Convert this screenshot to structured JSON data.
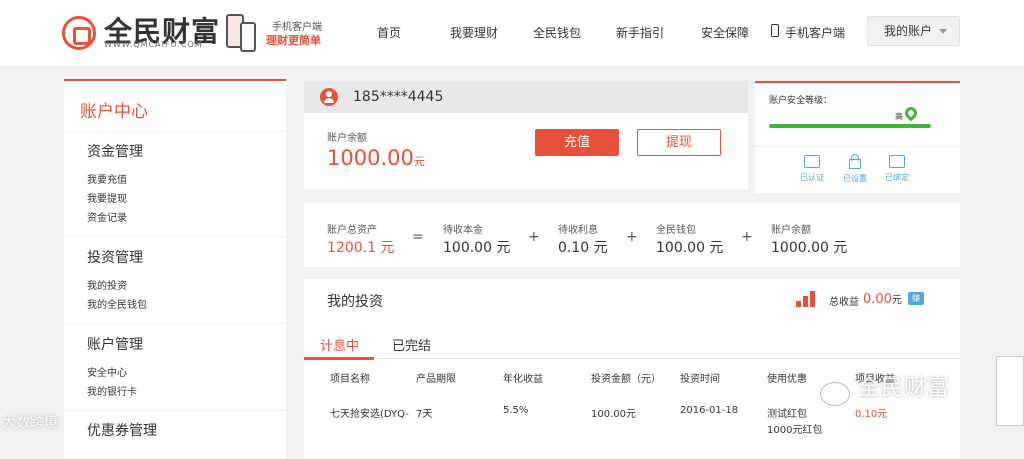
{
  "brand": {
    "name": "全民财富",
    "domain": "WWW.QMCAIFU.COM"
  },
  "app_promo": {
    "line1": "手机客户端",
    "line2": "理财更简单"
  },
  "nav": {
    "items": [
      "首页",
      "我要理财",
      "全民钱包",
      "新手指引",
      "安全保障",
      "手机客户端"
    ],
    "account": "我的账户"
  },
  "sidebar": {
    "title": "账户中心",
    "sections": [
      {
        "title": "资金管理",
        "links": [
          "我要充值",
          "我要提现",
          "资金记录"
        ]
      },
      {
        "title": "投资管理",
        "links": [
          "我的投资",
          "我的全民钱包"
        ]
      },
      {
        "title": "账户管理",
        "links": [
          "安全中心",
          "我的银行卡"
        ]
      },
      {
        "title": "优惠券管理",
        "links": []
      }
    ]
  },
  "account_card": {
    "phone": "185****4445",
    "balance_label": "账户余额",
    "balance": "1000.00",
    "balance_unit": "元",
    "charge_btn": "充值",
    "withdraw_btn": "提现"
  },
  "security": {
    "label": "账户安全等级：",
    "level": "高",
    "level_fraction": 1.0,
    "items": [
      "已认证",
      "已设置",
      "已绑定"
    ],
    "colors": {
      "bar": "#3db33d",
      "icons": "#4ea6d9"
    }
  },
  "summary": {
    "items": [
      {
        "label": "账户总资产",
        "value": "1200.1 元"
      },
      {
        "label": "待收本金",
        "value": "100.00 元"
      },
      {
        "label": "待收利息",
        "value": "0.10 元"
      },
      {
        "label": "全民钱包",
        "value": "100.00 元"
      },
      {
        "label": "账户余额",
        "value": "1000.00 元"
      }
    ],
    "ops": [
      "=",
      "+",
      "+",
      "+"
    ]
  },
  "investments": {
    "title": "我的投资",
    "total_label": "总收益",
    "total_value": "0.00",
    "total_unit": "元",
    "badge": "赚",
    "tabs": [
      "计息中",
      "已完结"
    ],
    "columns": [
      "项目名称",
      "产品期限",
      "年化收益",
      "投资金额（元）",
      "投资时间",
      "使用优惠",
      "项目收益"
    ],
    "rows": [
      {
        "name": "七天抢安选(DYQ-",
        "term": "7天",
        "rate": "5.5%",
        "amount": "100.00元",
        "date": "2016-01-18",
        "coupon": "测试红包",
        "coupon2": "1000元红包",
        "income": "0.10元"
      }
    ]
  },
  "overlay": {
    "watermark": "全民财富",
    "left_mark": "大数跨境"
  },
  "colors": {
    "accent": "#e8503a"
  }
}
